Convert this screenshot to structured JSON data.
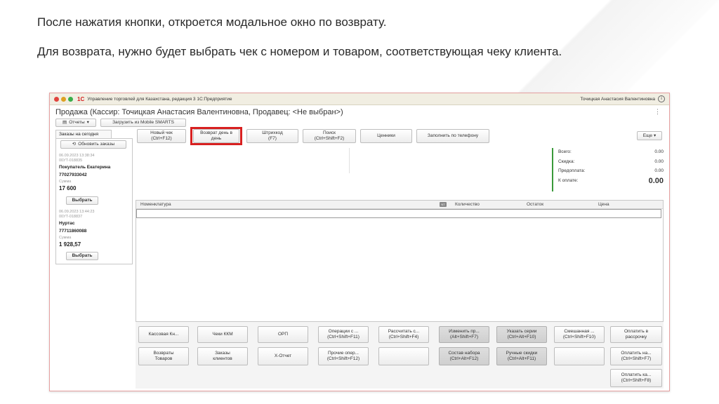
{
  "captions": {
    "line1": "После нажатия кнопки, откроется модальное окно по возврату.",
    "line2": "Для возврата, нужно будет выбрать чек с номером и товаром, соответствующая чеку клиента."
  },
  "window": {
    "app_title": "Управление торговлей для Казахстана, редакция 3 1С:Предприятие",
    "logo": "1С",
    "user": "Точицкая Анастасия Валентиновна",
    "doc_title": "Продажа (Кассир: Точицкая Анастасия Валентиновна, Продавец: <Не выбран>)"
  },
  "toolbar": {
    "reports": "Отчеты",
    "load_mobile": "Загрузить из Mobile SMARTS",
    "new_check": "Новый чек\n(Ctrl+F12)",
    "return_day": "Возврат день в день",
    "barcode": "Штрихкод\n(F7)",
    "search": "Поиск\n(Ctrl+Shift+F2)",
    "price_tags": "Ценники",
    "fill_by_phone": "Заполнить по телефону",
    "more": "Еще"
  },
  "orders": {
    "tab": "Заказы на сегодня",
    "refresh": "Обновить заказы",
    "items": [
      {
        "date": "06.09.2023 13:38:34",
        "number": "00УТ-018835",
        "client": "Покупатель Екатерина",
        "phone": "77027933042",
        "sum_label": "Сумма",
        "sum": "17 600",
        "select": "Выбрать"
      },
      {
        "date": "06.09.2023 13:44:23",
        "number": "00УТ-018837",
        "client": "Нуртас",
        "phone": "77711860088",
        "sum_label": "Сумма",
        "sum": "1 928,57",
        "select": "Выбрать"
      }
    ]
  },
  "totals": {
    "total_label": "Всего:",
    "total": "0.00",
    "discount_label": "Скидка:",
    "discount": "0.00",
    "prepay_label": "Предоплата:",
    "prepay": "0.00",
    "topay_label": "К оплате:",
    "topay": "0.00"
  },
  "table": {
    "columns": [
      "Номенклатура",
      "Количество",
      "Остаток",
      "Цена"
    ],
    "nt_badge": "NT"
  },
  "bottom_buttons": {
    "r1": [
      "Кассовая Кн...",
      "Чеки ККМ",
      "ОРП",
      "Операции с ...\n(Ctrl+Shift+F11)",
      "Рассчитать с...\n(Ctrl+Shift+F4)",
      "Изменить пр...\n(Alt+Shift+F7)",
      "Указать серии\n(Ctrl+Alt+F10)",
      "Смешанная ...\n(Ctrl+Shift+F10)",
      "Оплатить в\nрассрочку"
    ],
    "r2": [
      "Возвраты\nТоваров",
      "Заказы\nклиентов",
      "Х-Отчет",
      "Прочие опер...\n(Ctrl+Shift+F12)",
      "",
      "Состав набора\n(Ctrl+Alt+F12)",
      "Ручные скидки\n(Ctrl+Alt+F11)",
      "",
      "Оплатить на...\n(Ctrl+Shift+F7)"
    ],
    "r3": "Оплатить ка...\n(Ctrl+Shift+F8)"
  }
}
